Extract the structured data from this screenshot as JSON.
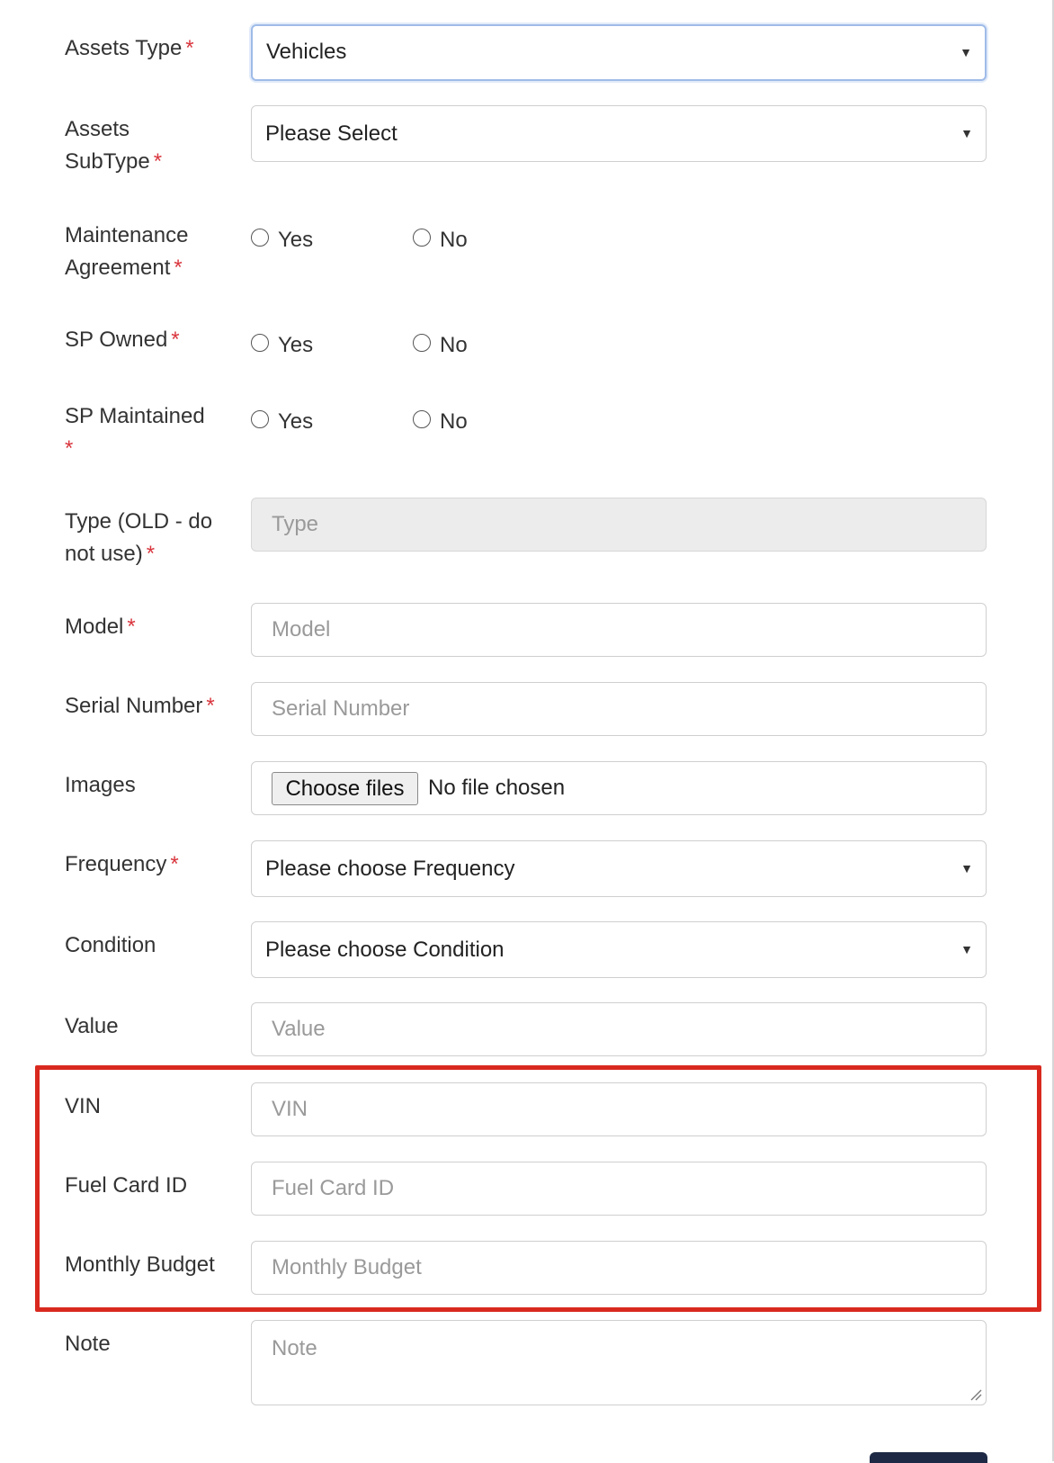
{
  "form": {
    "assets_type": {
      "label": "Assets Type",
      "required_mark": "*",
      "value": "Vehicles"
    },
    "assets_subtype": {
      "label_line1": "Assets",
      "label_line2": "SubType",
      "required_mark": "*",
      "value": "Please Select"
    },
    "maintenance_agreement": {
      "label_line1": "Maintenance",
      "label_line2": "Agreement",
      "required_mark": "*",
      "option_yes": "Yes",
      "option_no": "No"
    },
    "sp_owned": {
      "label": "SP Owned",
      "required_mark": "*",
      "option_yes": "Yes",
      "option_no": "No"
    },
    "sp_maintained": {
      "label": "SP Maintained",
      "required_mark": "*",
      "option_yes": "Yes",
      "option_no": "No"
    },
    "type_old": {
      "label_line1": "Type (OLD - do",
      "label_line2": "not use)",
      "required_mark": "*",
      "placeholder": "Type"
    },
    "model": {
      "label": "Model",
      "required_mark": "*",
      "placeholder": "Model"
    },
    "serial_number": {
      "label": "Serial Number",
      "required_mark": "*",
      "placeholder": "Serial Number"
    },
    "images": {
      "label": "Images",
      "button_label": "Choose files",
      "file_status": "No file chosen"
    },
    "frequency": {
      "label": "Frequency",
      "required_mark": "*",
      "value": "Please choose Frequency"
    },
    "condition": {
      "label": "Condition",
      "value": "Please choose Condition"
    },
    "value": {
      "label": "Value",
      "placeholder": "Value"
    },
    "vin": {
      "label": "VIN",
      "placeholder": "VIN"
    },
    "fuel_card_id": {
      "label": "Fuel Card ID",
      "placeholder": "Fuel Card ID"
    },
    "monthly_budget": {
      "label": "Monthly Budget",
      "placeholder": "Monthly Budget"
    },
    "note": {
      "label": "Note",
      "placeholder": "Note"
    }
  },
  "icons": {
    "dropdown": "chevron-down-icon",
    "resize": "resize-handle-icon"
  },
  "colors": {
    "required": "#d9363e",
    "highlight": "#d9291f",
    "focus_border": "#9fbbe8",
    "submit": "#1e2a45"
  }
}
